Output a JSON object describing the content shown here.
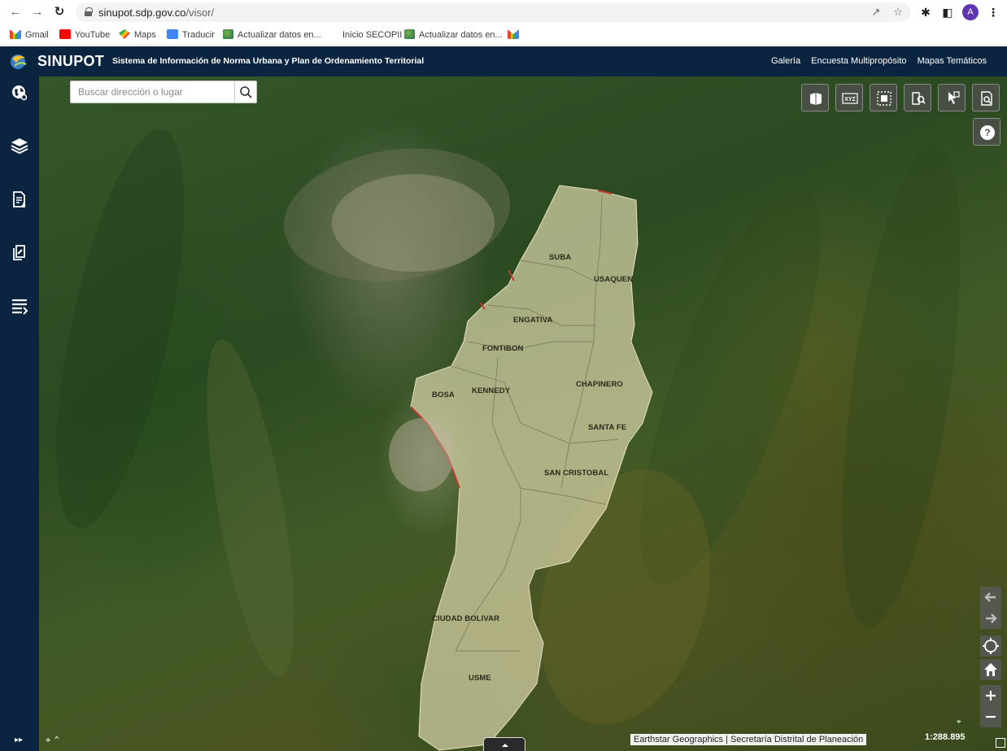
{
  "browser": {
    "url_host": "sinupot.sdp.gov.co",
    "url_path": "/visor/",
    "profile_initial": "A",
    "bookmarks": [
      {
        "label": "Gmail",
        "icon": "gmail-icon"
      },
      {
        "label": "YouTube",
        "icon": "youtube-icon"
      },
      {
        "label": "Maps",
        "icon": "maps-icon"
      },
      {
        "label": "Traducir",
        "icon": "translate-icon"
      },
      {
        "label": "Actualizar datos en...",
        "icon": "globe-icon"
      },
      {
        "label": "Inicio SECOPII",
        "icon": ""
      },
      {
        "label": "Actualizar datos en...",
        "icon": "globe-icon"
      },
      {
        "label": "",
        "icon": "gmail-icon"
      }
    ]
  },
  "header": {
    "app_name": "SINUPOT",
    "subtitle": "Sistema de Información de Norma Urbana y Plan de Ordenamiento Territorial",
    "links": [
      "Galería",
      "Encuesta Multipropósito",
      "Mapas Temáticos"
    ]
  },
  "sidebar": {
    "items": [
      "world-search-icon",
      "layers-icon",
      "document-list-icon",
      "edit-document-icon",
      "menu-list-icon"
    ]
  },
  "search": {
    "placeholder": "Buscar dirección o lugar"
  },
  "toolbar": {
    "tools": [
      "map-print-icon",
      "xyz-coordinates-icon",
      "select-area-icon",
      "search-document-icon",
      "identify-icon",
      "query-icon"
    ]
  },
  "map": {
    "localities": [
      "SUBA",
      "USAQUEN",
      "ENGATIVA",
      "FONTIBON",
      "CHAPINERO",
      "BOSA",
      "KENNEDY",
      "SANTA FE",
      "SAN CRISTOBAL",
      "CIUDAD BOLIVAR",
      "USME"
    ],
    "attribution": "Earthstar Geographics | Secretaría Distrital de Planeación",
    "scale": "1:288.895"
  },
  "colors": {
    "header_bg": "#0b2540",
    "district_fill": "#d8d2a8",
    "district_border": "#c0392b"
  }
}
